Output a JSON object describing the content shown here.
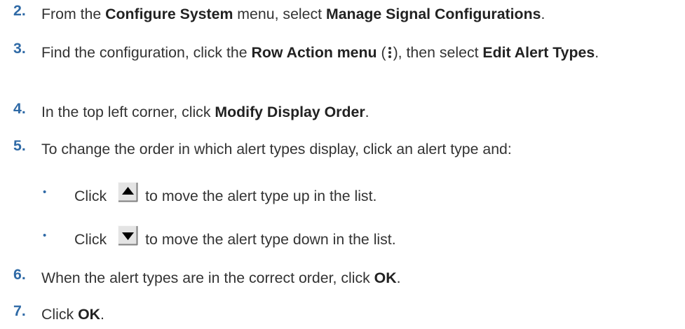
{
  "steps": [
    {
      "num": "2.",
      "parts": [
        "From the ",
        "Configure System",
        " menu, select ",
        "Manage Signal Configurations",
        "."
      ]
    },
    {
      "num": "3.",
      "parts": [
        "Find the configuration, click the ",
        "Row Action menu",
        " (",
        "), then select ",
        "Edit Alert Types",
        "."
      ]
    },
    {
      "num": "4.",
      "parts": [
        "In the top left corner, click ",
        "Modify Display Order",
        "."
      ]
    },
    {
      "num": "5.",
      "text": "To change the order in which alert types display, click an alert type and:",
      "sub": [
        {
          "bullet": "•",
          "pre": "Click",
          "post": "to move the alert type up in the list.",
          "icon": "move-up-arrow-icon"
        },
        {
          "bullet": "•",
          "pre": "Click",
          "post": "to move the alert type down in the list.",
          "icon": "move-down-arrow-icon"
        }
      ]
    },
    {
      "num": "6.",
      "parts": [
        "When the alert types are in the correct order, click ",
        "OK",
        "."
      ]
    },
    {
      "num": "7.",
      "parts": [
        "Click ",
        "OK",
        "."
      ]
    }
  ],
  "colors": {
    "step_number": "#2f6aa6",
    "body_text": "#333333"
  }
}
